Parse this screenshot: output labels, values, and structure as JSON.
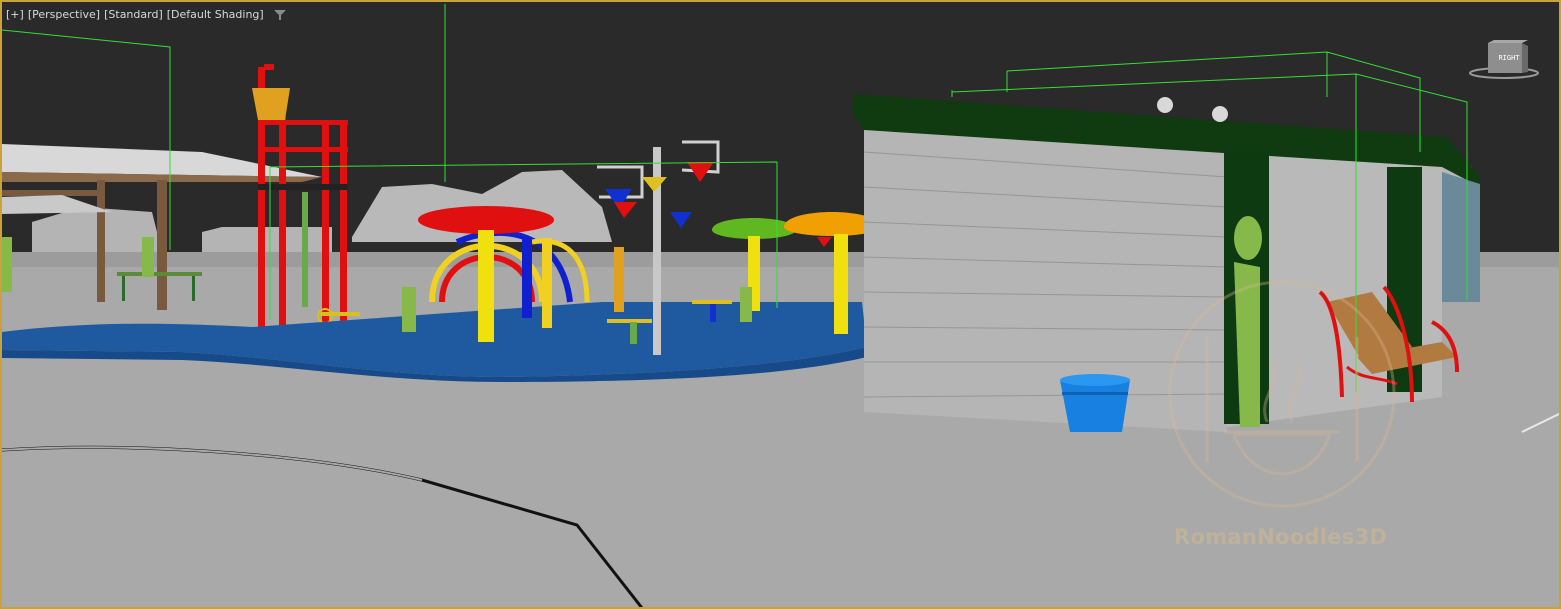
{
  "viewport": {
    "label_items": [
      "[+]",
      "[Perspective]",
      "[Standard]",
      "[Default Shading]"
    ],
    "filter_icon": "filter-icon",
    "border_color": "#c8a23c",
    "background_color": "#2a2a2a",
    "ground_color": "#a9a9a9"
  },
  "viewcube": {
    "face_label": "RIGHT",
    "icon": "viewcube-icon"
  },
  "watermark": {
    "text": "RomanNoodles3D",
    "icon": "noodle-bowl-logo"
  },
  "scene_objects": [
    "pavilion-shelter",
    "lifeguard-tower",
    "red-mushroom-fountain",
    "water-dump-bucket-pole",
    "green-mushroom-fountain",
    "orange-mushroom-fountain",
    "splash-pad-pool",
    "restroom-building",
    "blue-trash-can",
    "park-bench"
  ],
  "colors": {
    "selection_bbox": "#33e033",
    "brick": "#b5b5b5",
    "roof": "#103a10",
    "pool": "#1f5aa0"
  }
}
